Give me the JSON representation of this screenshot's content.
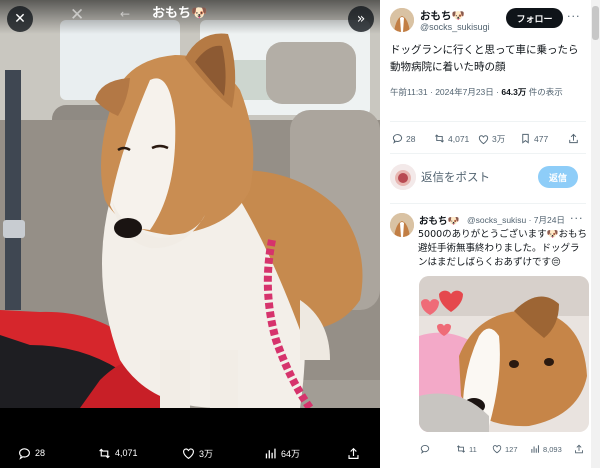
{
  "viewer": {
    "header_name": "おもち🐶",
    "close_icon": "close-icon",
    "expand_icon": "expand-icon",
    "actions": {
      "reply_count": "28",
      "retweet_count": "4,071",
      "like_count": "3万",
      "views_count": "64万"
    }
  },
  "post": {
    "author_name": "おもち",
    "author_emoji": "🐶",
    "author_handle": "@socks_sukisugi",
    "follow_label": "フォロー",
    "text": "ドッグランに行くと思って車に乗ったら動物病院に着いた時の顔",
    "meta_prefix": "午前11:31 · 2024年7月23日 · ",
    "views_value": "64.3万",
    "views_suffix": " 件の表示",
    "stats": {
      "replies": "28",
      "retweets": "4,071",
      "likes": "3万",
      "bookmarks": "477"
    }
  },
  "reply_composer": {
    "placeholder": "返信をポスト",
    "button_label": "返信"
  },
  "reply": {
    "author_name": "おもち",
    "author_emoji": "🐶",
    "author_handle": "@socks_sukisu",
    "timestamp": "· 7月24日",
    "text": "5000のありがとうございます🐶おもち避妊手術無事終わりました。ドッグランはまだしばらくおあずけです😔",
    "stats": {
      "replies": "",
      "retweets": "11",
      "likes": "127",
      "views": "8,093"
    }
  },
  "colors": {
    "accent": "#1d9bf0",
    "reply_button": "#8ecdf8",
    "text_primary": "#0f1419",
    "text_secondary": "#536471",
    "leash": "#d6336c"
  }
}
